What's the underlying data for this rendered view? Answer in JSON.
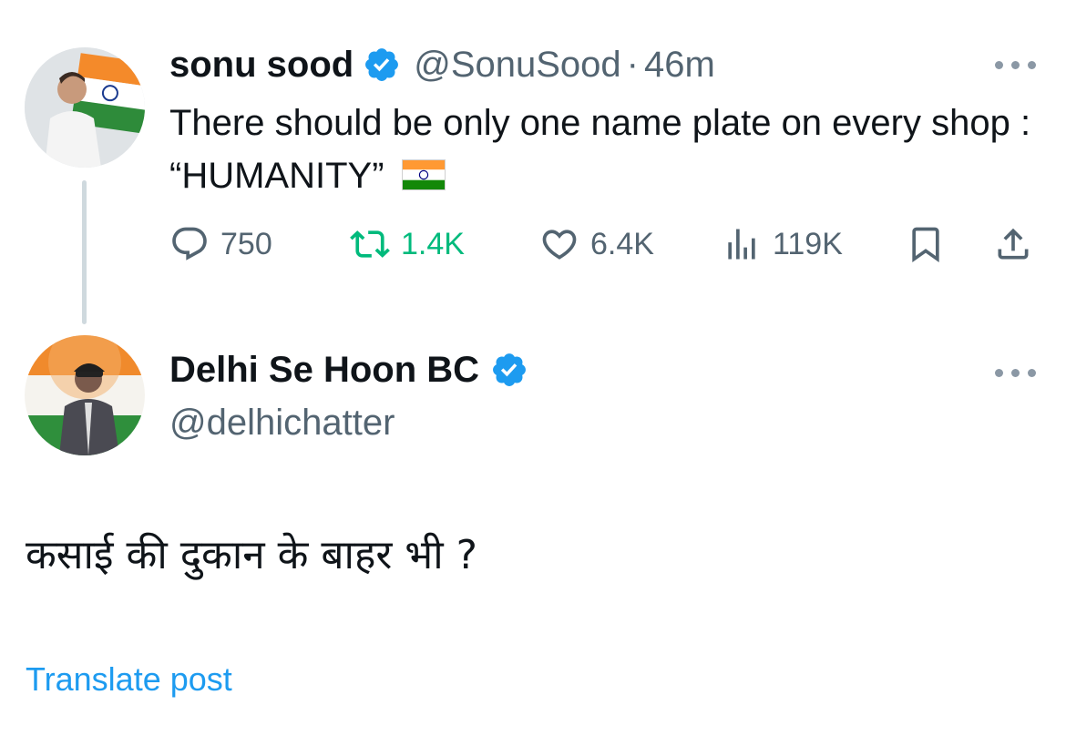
{
  "tweet": {
    "author_name": "sonu sood",
    "handle": "@SonuSood",
    "separator": "·",
    "time": "46m",
    "text": "There should be only one name plate on every shop : “HUMANITY”",
    "flag_icon": "india-flag-emoji",
    "stats": {
      "replies": "750",
      "reposts": "1.4K",
      "likes": "6.4K",
      "views": "119K"
    },
    "colors": {
      "verified": "#1d9bf0",
      "repost": "#00ba7c",
      "muted": "#536471"
    }
  },
  "reply": {
    "author_name": "Delhi Se Hoon BC",
    "handle": "@delhichatter",
    "text": "कसाई की दुकान के बाहर भी ?",
    "translate_label": "Translate post"
  }
}
